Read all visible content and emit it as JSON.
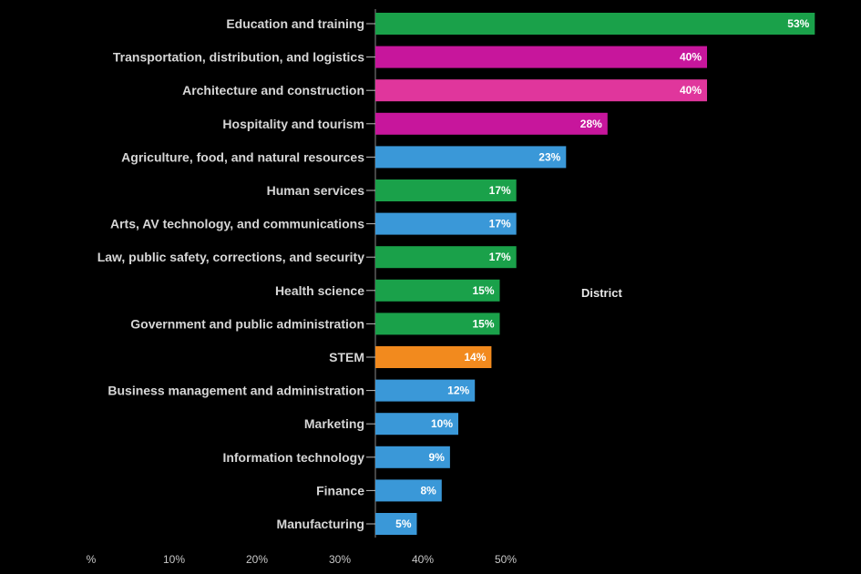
{
  "chart_data": {
    "type": "bar",
    "orientation": "horizontal",
    "title": "",
    "xlabel": "",
    "ylabel": "",
    "xlim": [
      0,
      60
    ],
    "x_ticks": [
      "%",
      "10%",
      "20%",
      "30%",
      "40%",
      "50%"
    ],
    "grid": false,
    "legend": "none",
    "annotations": [
      "District"
    ],
    "bars": [
      {
        "category": "Education and training",
        "value": 53,
        "label": "53%",
        "color": "#1aa14a"
      },
      {
        "category": "Transportation, distribution, and logistics",
        "value": 40,
        "label": "40%",
        "color": "#c7169c"
      },
      {
        "category": "Architecture and construction",
        "value": 40,
        "label": "40%",
        "color": "#e0369c"
      },
      {
        "category": "Hospitality and tourism",
        "value": 28,
        "label": "28%",
        "color": "#c7169c"
      },
      {
        "category": "Agriculture, food, and natural resources",
        "value": 23,
        "label": "23%",
        "color": "#3a98d8"
      },
      {
        "category": "Human services",
        "value": 17,
        "label": "17%",
        "color": "#1aa14a"
      },
      {
        "category": "Arts, AV technology, and communications",
        "value": 17,
        "label": "17%",
        "color": "#3a98d8"
      },
      {
        "category": "Law, public safety, corrections, and security",
        "value": 17,
        "label": "17%",
        "color": "#1aa14a"
      },
      {
        "category": "Health science",
        "value": 15,
        "label": "15%",
        "color": "#1aa14a"
      },
      {
        "category": "Government and public administration",
        "value": 15,
        "label": "15%",
        "color": "#1aa14a"
      },
      {
        "category": "STEM",
        "value": 14,
        "label": "14%",
        "color": "#f28a1e"
      },
      {
        "category": "Business management and administration",
        "value": 12,
        "label": "12%",
        "color": "#3a98d8"
      },
      {
        "category": "Marketing",
        "value": 10,
        "label": "10%",
        "color": "#3a98d8"
      },
      {
        "category": "Information technology",
        "value": 9,
        "label": "9%",
        "color": "#3a98d8"
      },
      {
        "category": "Finance",
        "value": 8,
        "label": "8%",
        "color": "#3a98d8"
      },
      {
        "category": "Manufacturing",
        "value": 5,
        "label": "5%",
        "color": "#3a98d8"
      }
    ]
  }
}
